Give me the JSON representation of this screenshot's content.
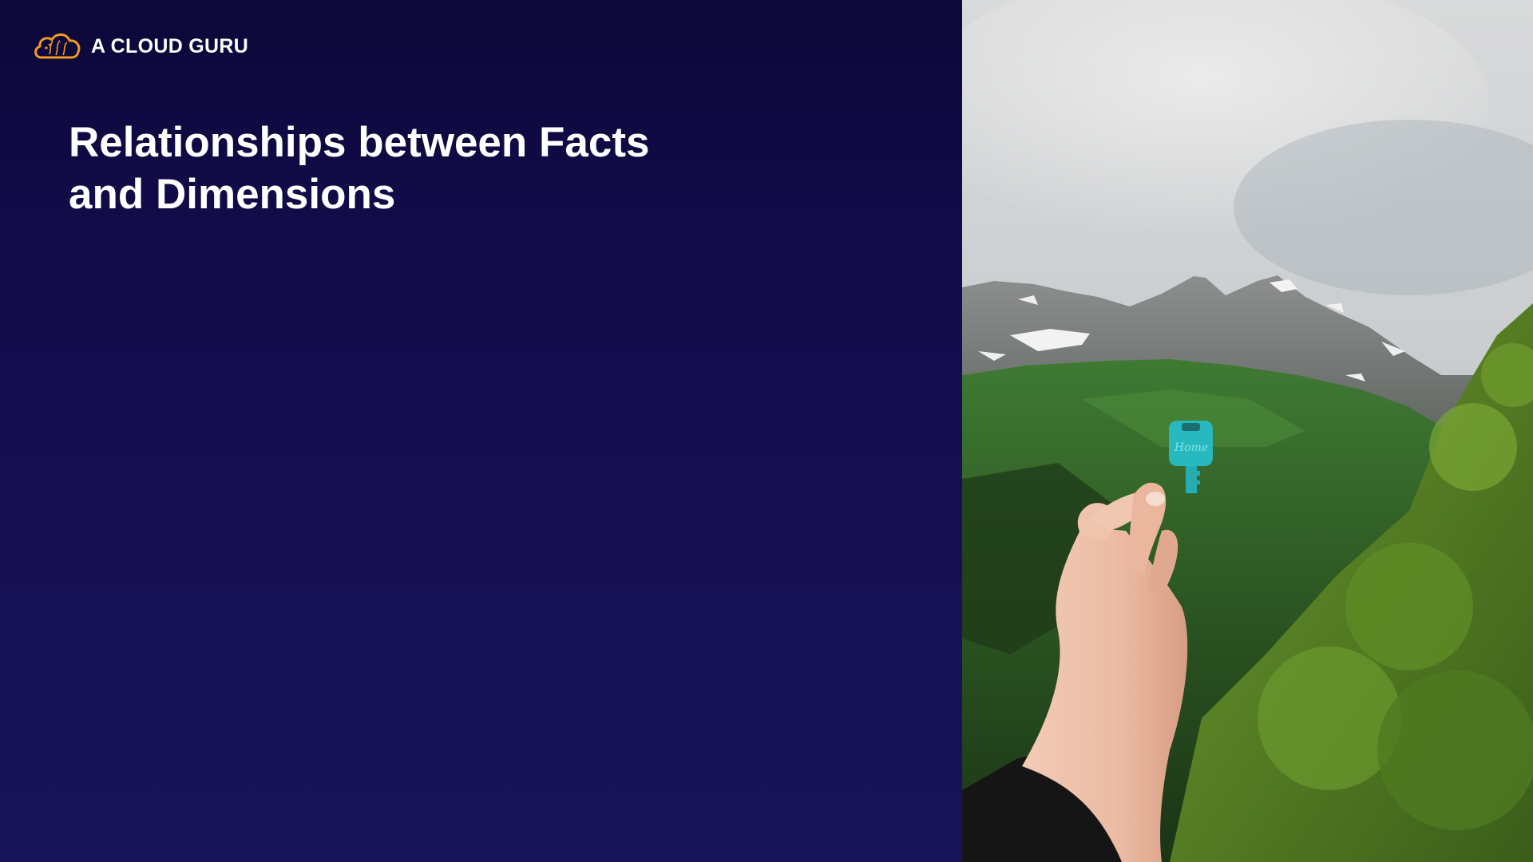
{
  "brand": {
    "name": "A CLOUD GURU",
    "logo_icon": "cloud-logo-icon",
    "logo_color": "#f29a1f"
  },
  "slide": {
    "title_line_1": "Relationships between Facts",
    "title_line_2": "and Dimensions",
    "background_color": "#150f4f",
    "title_color": "#ffffff"
  },
  "photo": {
    "subject": "hand-holding-key-photo",
    "key_icon": "key-icon",
    "key_color": "#28b8bf",
    "key_engraving": "Home"
  }
}
